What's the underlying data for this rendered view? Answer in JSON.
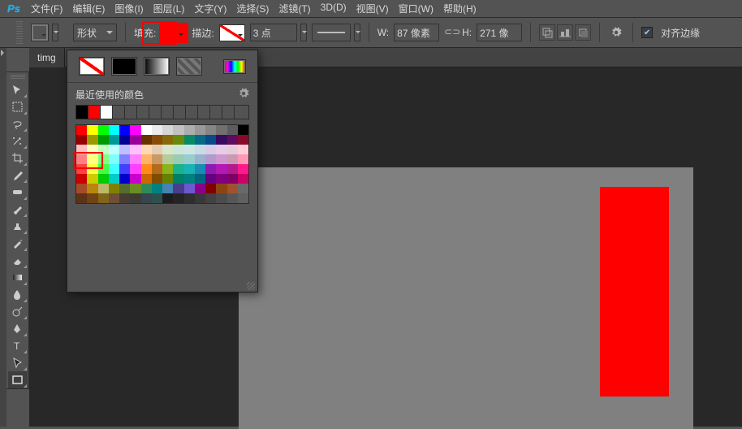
{
  "app": {
    "logo": "Ps"
  },
  "menu": {
    "items": [
      "文件(F)",
      "编辑(E)",
      "图像(I)",
      "图层(L)",
      "文字(Y)",
      "选择(S)",
      "滤镜(T)",
      "3D(D)",
      "视图(V)",
      "窗口(W)",
      "帮助(H)"
    ]
  },
  "options": {
    "shape_label": "形状",
    "fill_label": "填充:",
    "stroke_label": "描边:",
    "stroke_points": "3 点",
    "width_label": "W:",
    "width_value": "87 像素",
    "height_label": "H:",
    "height_value": "271 像",
    "align_label": "对齐边缘",
    "chain_icon": "⬭"
  },
  "doc": {
    "tab_title": "timg"
  },
  "colorpanel": {
    "recent_label": "最近使用的颜色",
    "recent": [
      "#000000",
      "#ff0000",
      "#ffffff"
    ],
    "row1": [
      "#ff0000",
      "#ffff00",
      "#00ff00",
      "#00ffff",
      "#0000ff",
      "#ff00ff",
      "#ffffff",
      "#ebebeb",
      "#d6d6d6",
      "#c2c2c2",
      "#adadad",
      "#999999",
      "#858585",
      "#707070",
      "#5c5c5c",
      "#000000"
    ],
    "row2": [
      "#990000",
      "#999900",
      "#009900",
      "#009999",
      "#000099",
      "#990099",
      "#663300",
      "#8a4b08",
      "#886a08",
      "#688a08",
      "#088a68",
      "#086a87",
      "#084b8a",
      "#380b61",
      "#5f0b5f",
      "#8a0829"
    ],
    "row3": [
      "#ffbfbf",
      "#ffffbf",
      "#bfffbf",
      "#bfffff",
      "#bfbfff",
      "#ffbfff",
      "#ffd9b3",
      "#e6ccb3",
      "#d9e6cc",
      "#cce6d9",
      "#cce6e6",
      "#ccd9e6",
      "#d9cce6",
      "#e6cce6",
      "#e6ccd9",
      "#ffccd9"
    ],
    "row4": [
      "#ff8080",
      "#ffff80",
      "#80ff80",
      "#80ffff",
      "#8080ff",
      "#ff80ff",
      "#ffb366",
      "#cc9966",
      "#b3cc99",
      "#99ccb3",
      "#99cccc",
      "#99b3cc",
      "#b399cc",
      "#cc99cc",
      "#cc99b3",
      "#ff99b3"
    ],
    "row5": [
      "#ff4040",
      "#ffff40",
      "#40ff40",
      "#40ffff",
      "#4040ff",
      "#ff40ff",
      "#ff8c1a",
      "#b36b1a",
      "#8cb31a",
      "#1ab38c",
      "#1ab3b3",
      "#1a8cb3",
      "#8c1ab3",
      "#b31ab3",
      "#b31a8c",
      "#ff1a8c"
    ],
    "row6": [
      "#cc0000",
      "#cccc00",
      "#00cc00",
      "#00cccc",
      "#0000cc",
      "#cc00cc",
      "#cc6600",
      "#804d00",
      "#668000",
      "#008066",
      "#008080",
      "#006680",
      "#660080",
      "#800080",
      "#800066",
      "#cc0066"
    ],
    "row7": [
      "#a64b29",
      "#b8860b",
      "#bdb76b",
      "#808000",
      "#556b2f",
      "#6b8e23",
      "#2e8b57",
      "#008080",
      "#4682b4",
      "#483d8b",
      "#6a5acd",
      "#8b008b",
      "#800000",
      "#8b4513",
      "#a0522d",
      "#696969"
    ],
    "row8": [
      "#5c3317",
      "#704214",
      "#806517",
      "#6f4e37",
      "#483c32",
      "#3b3c36",
      "#36454f",
      "#2f4f4f",
      "#1c1c1c",
      "#242424",
      "#2e2e2e",
      "#383838",
      "#424242",
      "#4c4c4c",
      "#565656",
      "#606060"
    ]
  },
  "chart_data": null
}
